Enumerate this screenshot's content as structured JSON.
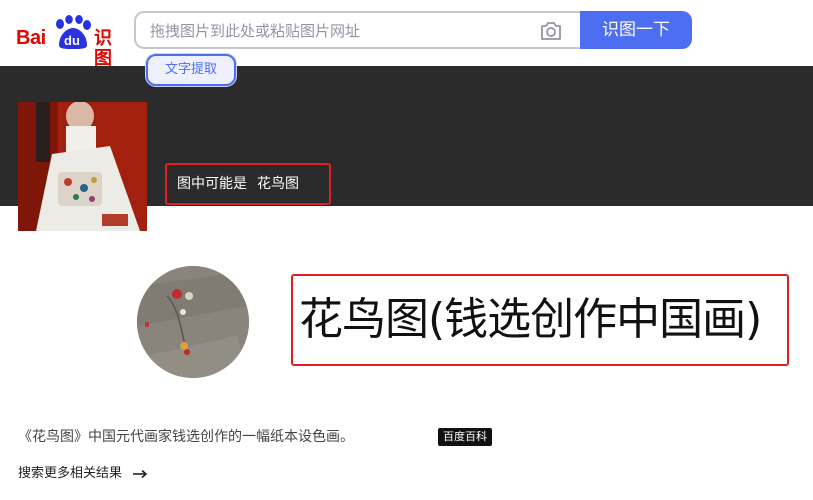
{
  "header": {
    "logo": {
      "bai": "Bai",
      "du": "du",
      "shitu": "识图"
    },
    "search": {
      "placeholder": "拖拽图片到此处或粘贴图片网址",
      "camera_icon": "camera-icon"
    },
    "search_button": "识图一下",
    "ocr_button": "文字提取"
  },
  "result": {
    "prefix": "图中可能是",
    "guess": "花鸟图"
  },
  "entity": {
    "title": "花鸟图(钱选创作中国画)",
    "description": "《花鸟图》中国元代画家钱选创作的一幅纸本设色画。",
    "source_badge": "百度百科",
    "more_link": "搜索更多相关结果",
    "arrow_icon": "arrow-right-icon"
  },
  "colors": {
    "brand_red": "#e10602",
    "brand_blue": "#4e6ef2",
    "highlight_red": "#e02020",
    "dark_band": "#2b2b2b"
  }
}
